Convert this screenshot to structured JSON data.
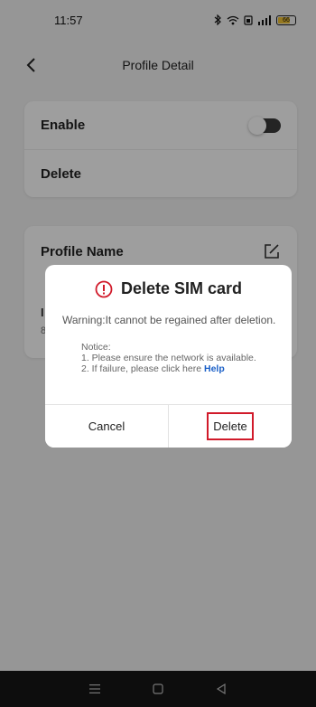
{
  "status_bar": {
    "time": "11:57",
    "battery": "66"
  },
  "header": {
    "title": "Profile Detail"
  },
  "settings_card": {
    "enable_label": "Enable",
    "delete_label": "Delete"
  },
  "profile_card": {
    "profile_name_label": "Profile Name",
    "stub_label": "I",
    "stub_sub": "8"
  },
  "dialog": {
    "title": "Delete SIM card",
    "warning": "Warning:It cannot be regained after deletion.",
    "notice_title": "Notice:",
    "notice_1": "1. Please ensure the network is available.",
    "notice_2": "2. If failure, please click here",
    "help_link": "Help",
    "cancel_label": "Cancel",
    "delete_label": "Delete"
  },
  "colors": {
    "accent_link": "#1a5fc7",
    "warning_red": "#d11a2a",
    "highlight_border": "#d11a2a"
  },
  "icons": {
    "back": "chevron-left-icon",
    "edit": "edit-icon",
    "warning": "exclamation-circle-icon",
    "nav_menu": "menu-icon",
    "nav_home": "home-icon",
    "nav_back": "triangle-back-icon"
  }
}
